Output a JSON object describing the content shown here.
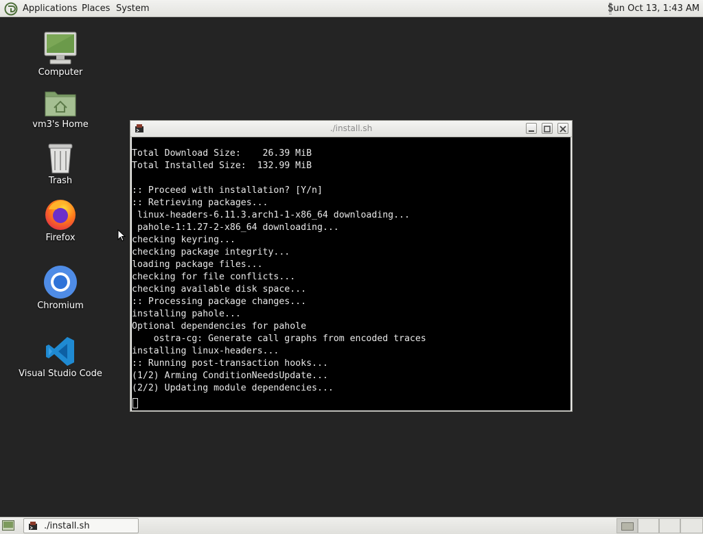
{
  "top_panel": {
    "menus": [
      "Applications",
      "Places",
      "System"
    ],
    "clock": "Sun Oct 13,  1:43 AM"
  },
  "desktop_icons": [
    {
      "label": "Computer",
      "icon": "computer-icon"
    },
    {
      "label": "vm3's Home",
      "icon": "home-folder-icon"
    },
    {
      "label": "Trash",
      "icon": "trash-icon"
    },
    {
      "label": "Firefox",
      "icon": "firefox-icon"
    },
    {
      "label": "Chromium",
      "icon": "chromium-icon"
    },
    {
      "label": "Visual Studio Code",
      "icon": "vscode-icon"
    }
  ],
  "window": {
    "title": "./install.sh",
    "controls": [
      "minimize",
      "maximize",
      "close"
    ]
  },
  "terminal": {
    "lines": [
      "Total Download Size:    26.39 MiB",
      "Total Installed Size:  132.99 MiB",
      "",
      ":: Proceed with installation? [Y/n]",
      ":: Retrieving packages...",
      " linux-headers-6.11.3.arch1-1-x86_64 downloading...",
      " pahole-1:1.27-2-x86_64 downloading...",
      "checking keyring...",
      "checking package integrity...",
      "loading package files...",
      "checking for file conflicts...",
      "checking available disk space...",
      ":: Processing package changes...",
      "installing pahole...",
      "Optional dependencies for pahole",
      "    ostra-cg: Generate call graphs from encoded traces",
      "installing linux-headers...",
      ":: Running post-transaction hooks...",
      "(1/2) Arming ConditionNeedsUpdate...",
      "(2/2) Updating module dependencies..."
    ]
  },
  "taskbar": {
    "items": [
      {
        "label": "./install.sh",
        "icon": "terminal-icon"
      }
    ],
    "workspaces": 4,
    "active_workspace": 1
  },
  "colors": {
    "desktop": "#242424",
    "terminal_bg": "#000000",
    "terminal_fg": "#e8e8e8",
    "panel": "#ecece9"
  }
}
